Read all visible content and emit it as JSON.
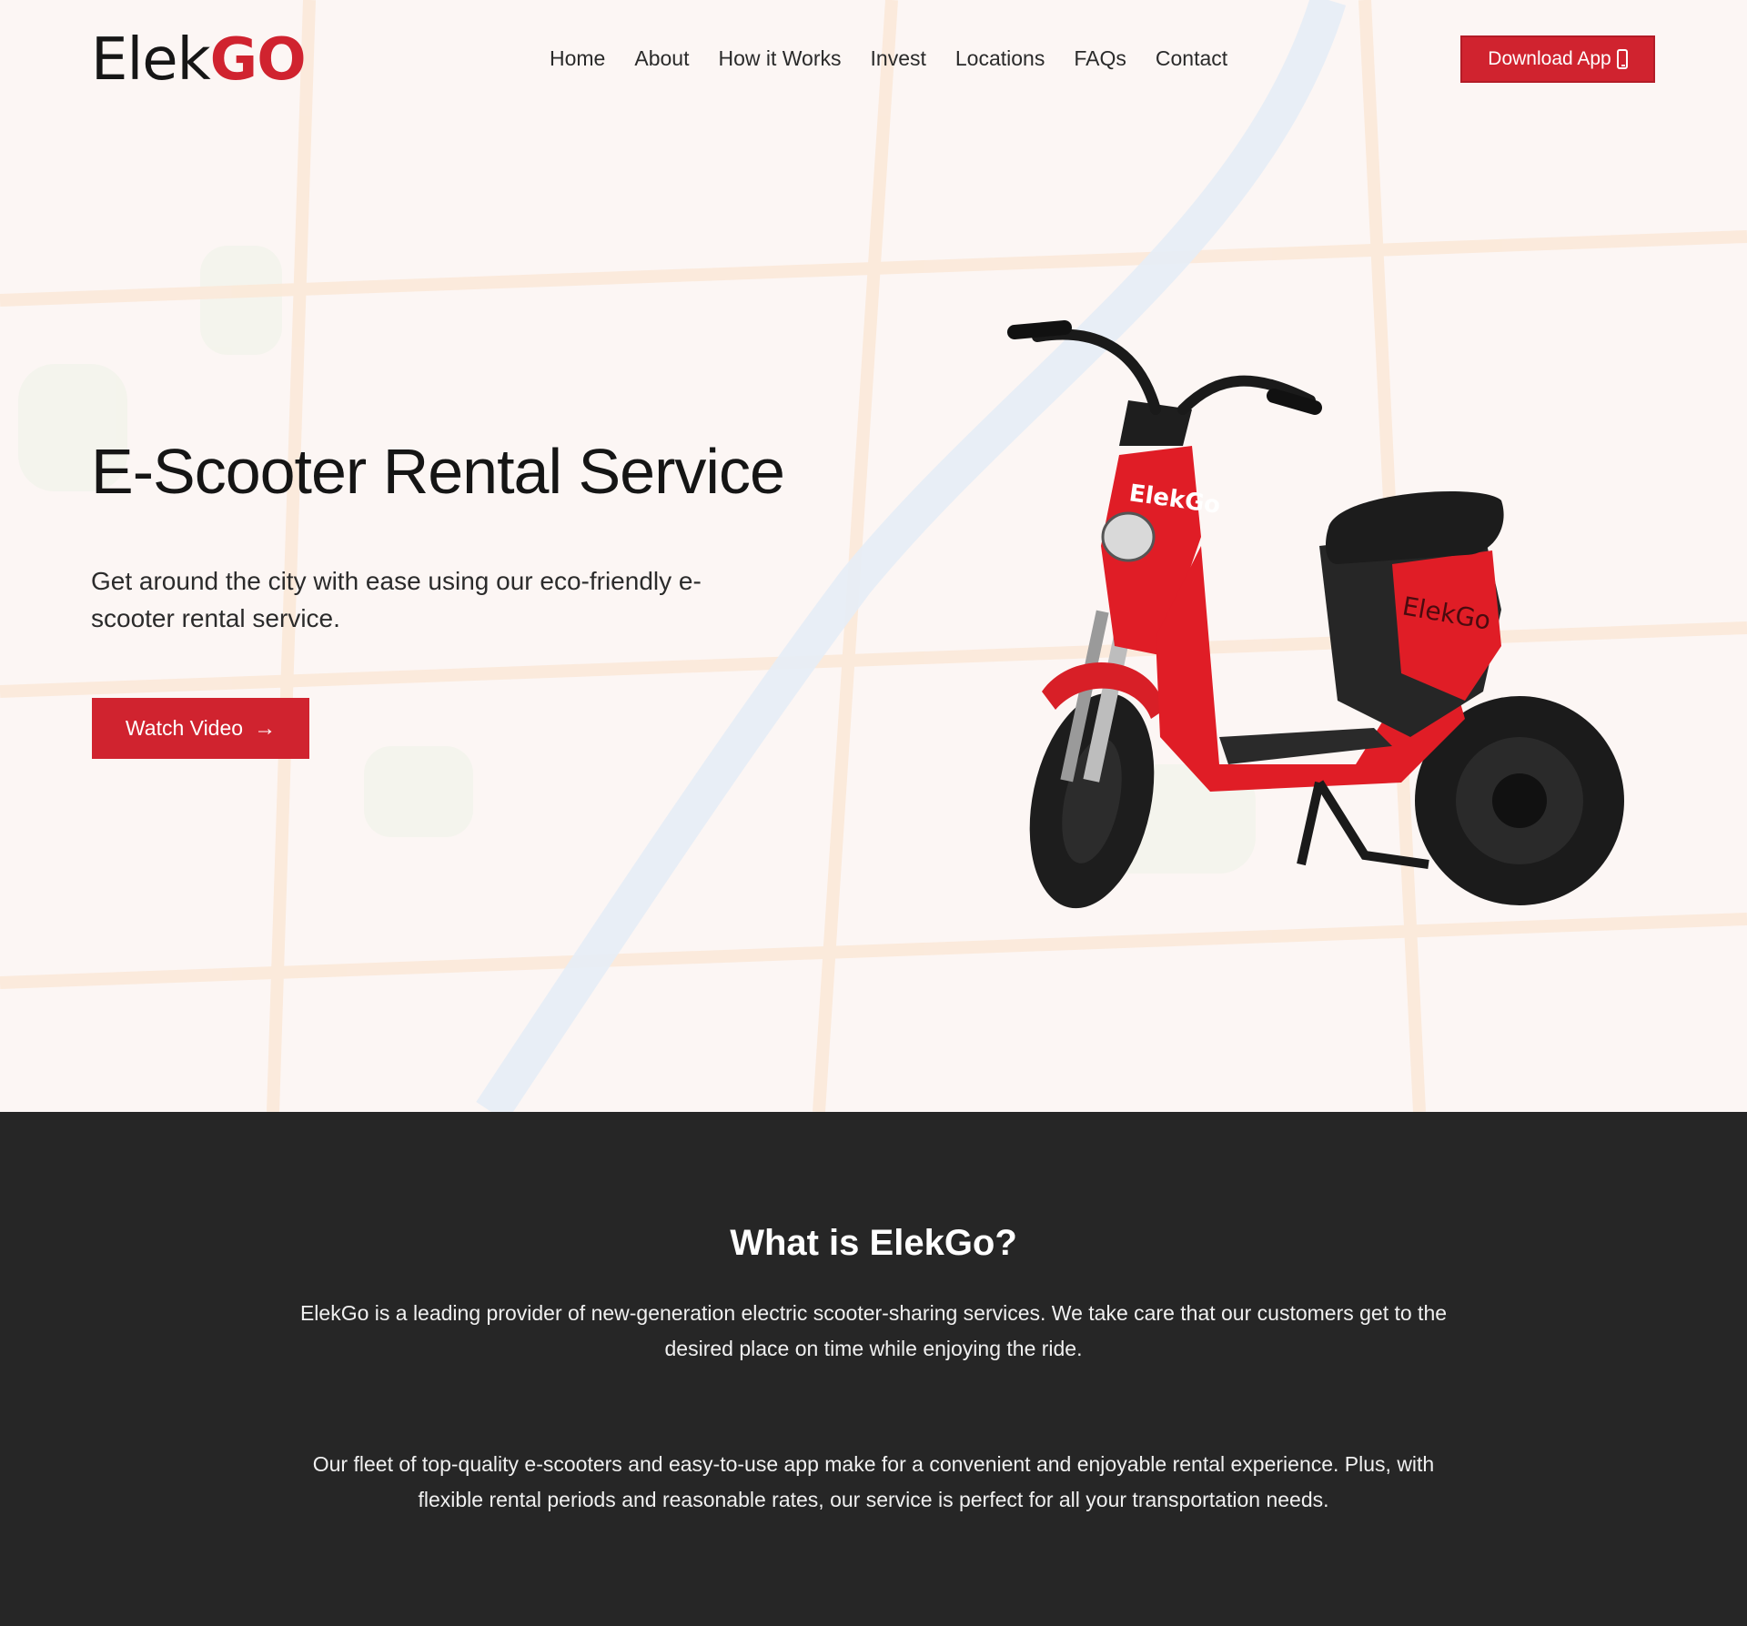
{
  "header": {
    "logo_part1": "Elek",
    "logo_part2": "GO",
    "nav": [
      "Home",
      "About",
      "How it Works",
      "Invest",
      "Locations",
      "FAQs",
      "Contact"
    ],
    "download_label": "Download App",
    "download_icon": "phone-icon"
  },
  "hero": {
    "title": "E-Scooter Rental Service",
    "subtitle": "Get around the city with ease using our eco-friendly e-scooter rental service.",
    "watch_label": "Watch Video",
    "watch_icon": "arrow-right-icon",
    "scooter_brand_front": "ElekGo",
    "scooter_brand_side": "ElekGo"
  },
  "about": {
    "heading": "What is ElekGo?",
    "paragraph1": "ElekGo is a leading provider of new-generation electric scooter-sharing services. We take care that our customers get to the desired place on time while enjoying the ride.",
    "paragraph2": "Our fleet of top-quality e-scooters and easy-to-use app make for a convenient and enjoyable rental experience. Plus, with flexible rental periods and reasonable rates, our service is perfect for all your transportation needs."
  },
  "colors": {
    "accent": "#d0232f",
    "dark_section": "#262626",
    "hero_bg": "#fcf6f4"
  }
}
